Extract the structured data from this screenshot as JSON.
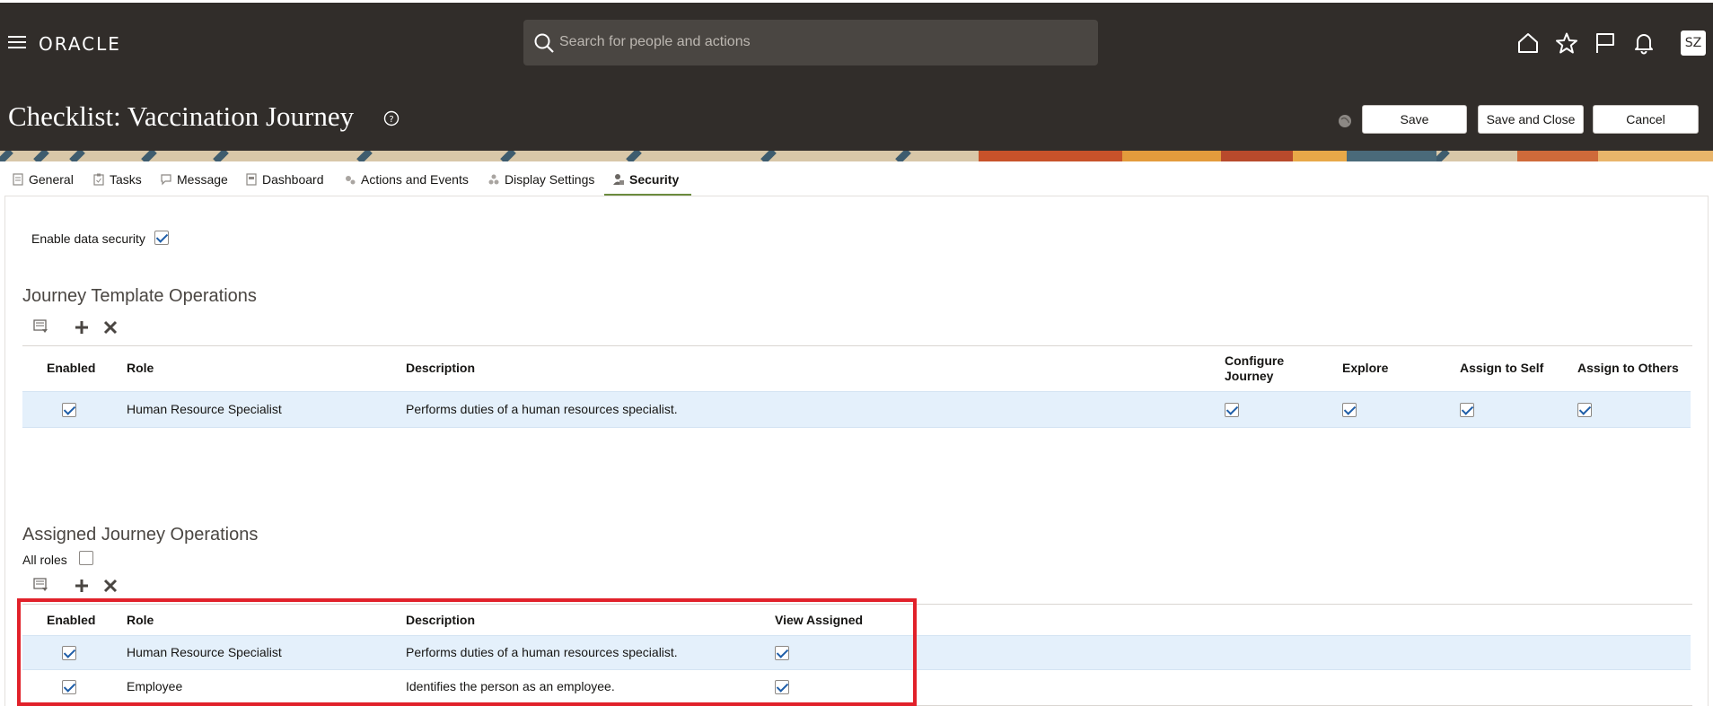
{
  "header": {
    "logo": "ORACLE",
    "search_placeholder": "Search for people and actions",
    "avatar_initials": "SZ",
    "icons": [
      "home-icon",
      "star-icon",
      "flag-icon",
      "bell-icon"
    ]
  },
  "page": {
    "title": "Checklist: Vaccination Journey",
    "buttons": {
      "save": "Save",
      "save_and_close": "Save and Close",
      "cancel": "Cancel"
    }
  },
  "tabs": [
    {
      "label": "General",
      "icon": "document-icon"
    },
    {
      "label": "Tasks",
      "icon": "clipboard-icon"
    },
    {
      "label": "Message",
      "icon": "message-icon"
    },
    {
      "label": "Dashboard",
      "icon": "dashboard-icon"
    },
    {
      "label": "Actions and Events",
      "icon": "gears-icon"
    },
    {
      "label": "Display Settings",
      "icon": "display-settings-icon"
    },
    {
      "label": "Security",
      "icon": "security-user-icon",
      "active": true
    }
  ],
  "security": {
    "enable_data_security_label": "Enable data security",
    "enable_data_security": true
  },
  "template_ops": {
    "title": "Journey Template Operations",
    "columns": {
      "enabled": "Enabled",
      "role": "Role",
      "description": "Description",
      "configure_1": "Configure",
      "configure_2": "Journey",
      "explore": "Explore",
      "assign_self": "Assign to Self",
      "assign_others": "Assign to Others"
    },
    "rows": [
      {
        "enabled": true,
        "role": "Human Resource Specialist",
        "description": "Performs duties of a human resources specialist.",
        "configure": true,
        "explore": true,
        "assign_self": true,
        "assign_others": true
      }
    ]
  },
  "assigned_ops": {
    "title": "Assigned Journey Operations",
    "all_roles_label": "All roles",
    "all_roles": false,
    "columns": {
      "enabled": "Enabled",
      "role": "Role",
      "description": "Description",
      "view_assigned": "View Assigned"
    },
    "rows": [
      {
        "enabled": true,
        "role": "Human Resource Specialist",
        "description": "Performs duties of a human resources specialist.",
        "view_assigned": true
      },
      {
        "enabled": true,
        "role": "Employee",
        "description": "Identifies the person as an employee.",
        "view_assigned": true
      }
    ]
  },
  "colors": {
    "header_bg": "#312d2a",
    "selected_row": "#e4f0fb",
    "active_tab_underline": "#6b8b3e",
    "highlight_border": "#e1212a",
    "checkbox_check": "#1f5ea8"
  }
}
